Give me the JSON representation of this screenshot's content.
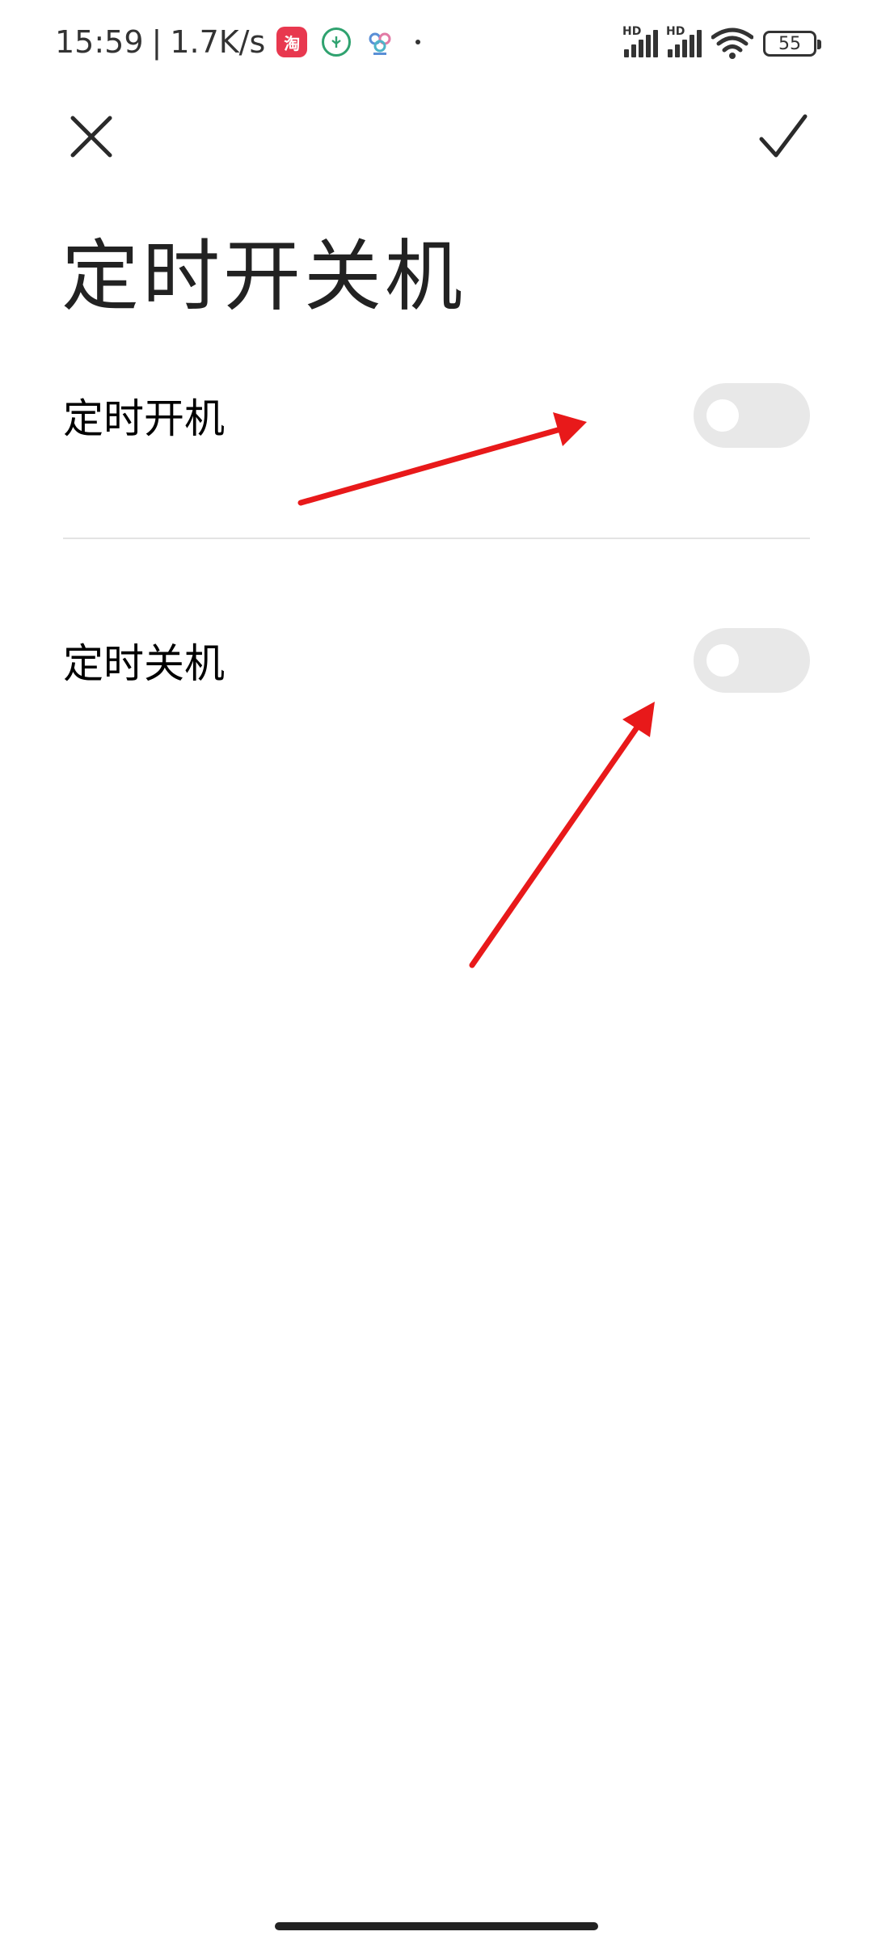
{
  "status_bar": {
    "time": "15:59",
    "separator": "|",
    "net_speed": "1.7K/s",
    "battery_level": "55",
    "hd_label_1": "HD",
    "hd_label_2": "HD",
    "taobao_glyph": "淘"
  },
  "header": {
    "close_icon": "close-icon",
    "confirm_icon": "check-icon"
  },
  "page": {
    "title": "定时开关机"
  },
  "settings": [
    {
      "label": "定时开机",
      "enabled": false
    },
    {
      "label": "定时关机",
      "enabled": false
    }
  ],
  "colors": {
    "toggle_off_track": "#e8e8e8",
    "annotation_arrow": "#e8191a",
    "divider": "#e3e3e3"
  }
}
